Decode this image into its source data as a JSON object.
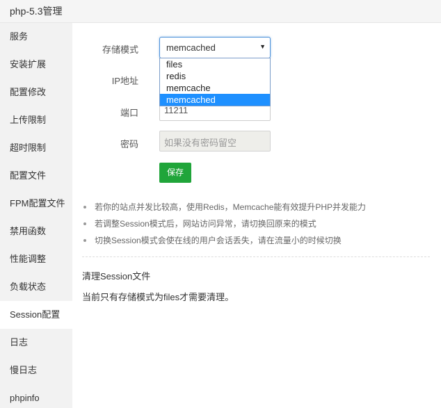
{
  "window": {
    "title": "php-5.3管理"
  },
  "sidebar": {
    "items": [
      {
        "label": "服务"
      },
      {
        "label": "安装扩展"
      },
      {
        "label": "配置修改"
      },
      {
        "label": "上传限制"
      },
      {
        "label": "超时限制"
      },
      {
        "label": "配置文件"
      },
      {
        "label": "FPM配置文件"
      },
      {
        "label": "禁用函数"
      },
      {
        "label": "性能调整"
      },
      {
        "label": "负载状态"
      },
      {
        "label": "Session配置"
      },
      {
        "label": "日志"
      },
      {
        "label": "慢日志"
      },
      {
        "label": "phpinfo"
      }
    ],
    "active": "Session配置"
  },
  "form": {
    "storage_mode": {
      "label": "存储模式",
      "value": "memcached",
      "options": [
        "files",
        "redis",
        "memcache",
        "memcached"
      ]
    },
    "ip": {
      "label": "IP地址",
      "value": ""
    },
    "port": {
      "label": "端口",
      "value": "11211"
    },
    "password": {
      "label": "密码",
      "placeholder": "如果没有密码留空"
    },
    "save_label": "保存"
  },
  "tips": [
    "若你的站点并发比较高，使用Redis，Memcache能有效提升PHP并发能力",
    "若调整Session模式后，网站访问异常，请切换回原来的模式",
    "切换Session模式会使在线的用户会话丢失，请在流量小的时候切换"
  ],
  "cleanup": {
    "title": "清理Session文件",
    "note": "当前只有存储模式为files才需要清理。"
  },
  "colors": {
    "accent": "#20a53a",
    "dropdown_highlight": "#1e90ff",
    "focus_border": "#4a90d9"
  }
}
